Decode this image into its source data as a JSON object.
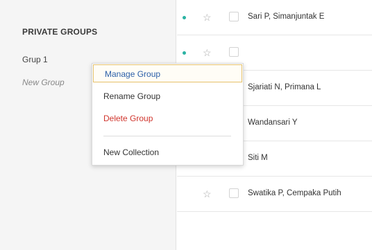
{
  "sidebar": {
    "heading": "PRIVATE GROUPS",
    "items": [
      {
        "label": "Grup 1"
      },
      {
        "label": "New Group"
      }
    ]
  },
  "list": {
    "rows": [
      {
        "unread": true,
        "starred": false,
        "author": "Sari P, Simanjuntak E"
      },
      {
        "unread": true,
        "starred": false,
        "author": ""
      },
      {
        "unread": false,
        "starred": false,
        "author": "Sjariati N, Primana L"
      },
      {
        "unread": false,
        "starred": false,
        "author": "Wandansari Y"
      },
      {
        "unread": false,
        "starred": false,
        "author": "Siti M"
      },
      {
        "unread": false,
        "starred": false,
        "author": "Swatika P, Cempaka Putih"
      }
    ],
    "star_glyph": "☆"
  },
  "context_menu": {
    "manage_label": "Manage Group",
    "rename_label": "Rename Group",
    "delete_label": "Delete Group",
    "new_collection_label": "New Collection"
  },
  "colors": {
    "accent_teal": "#2bb3a3",
    "highlight_border": "#e5c16a",
    "link_blue": "#2b5fa8",
    "danger_red": "#d0342c"
  }
}
